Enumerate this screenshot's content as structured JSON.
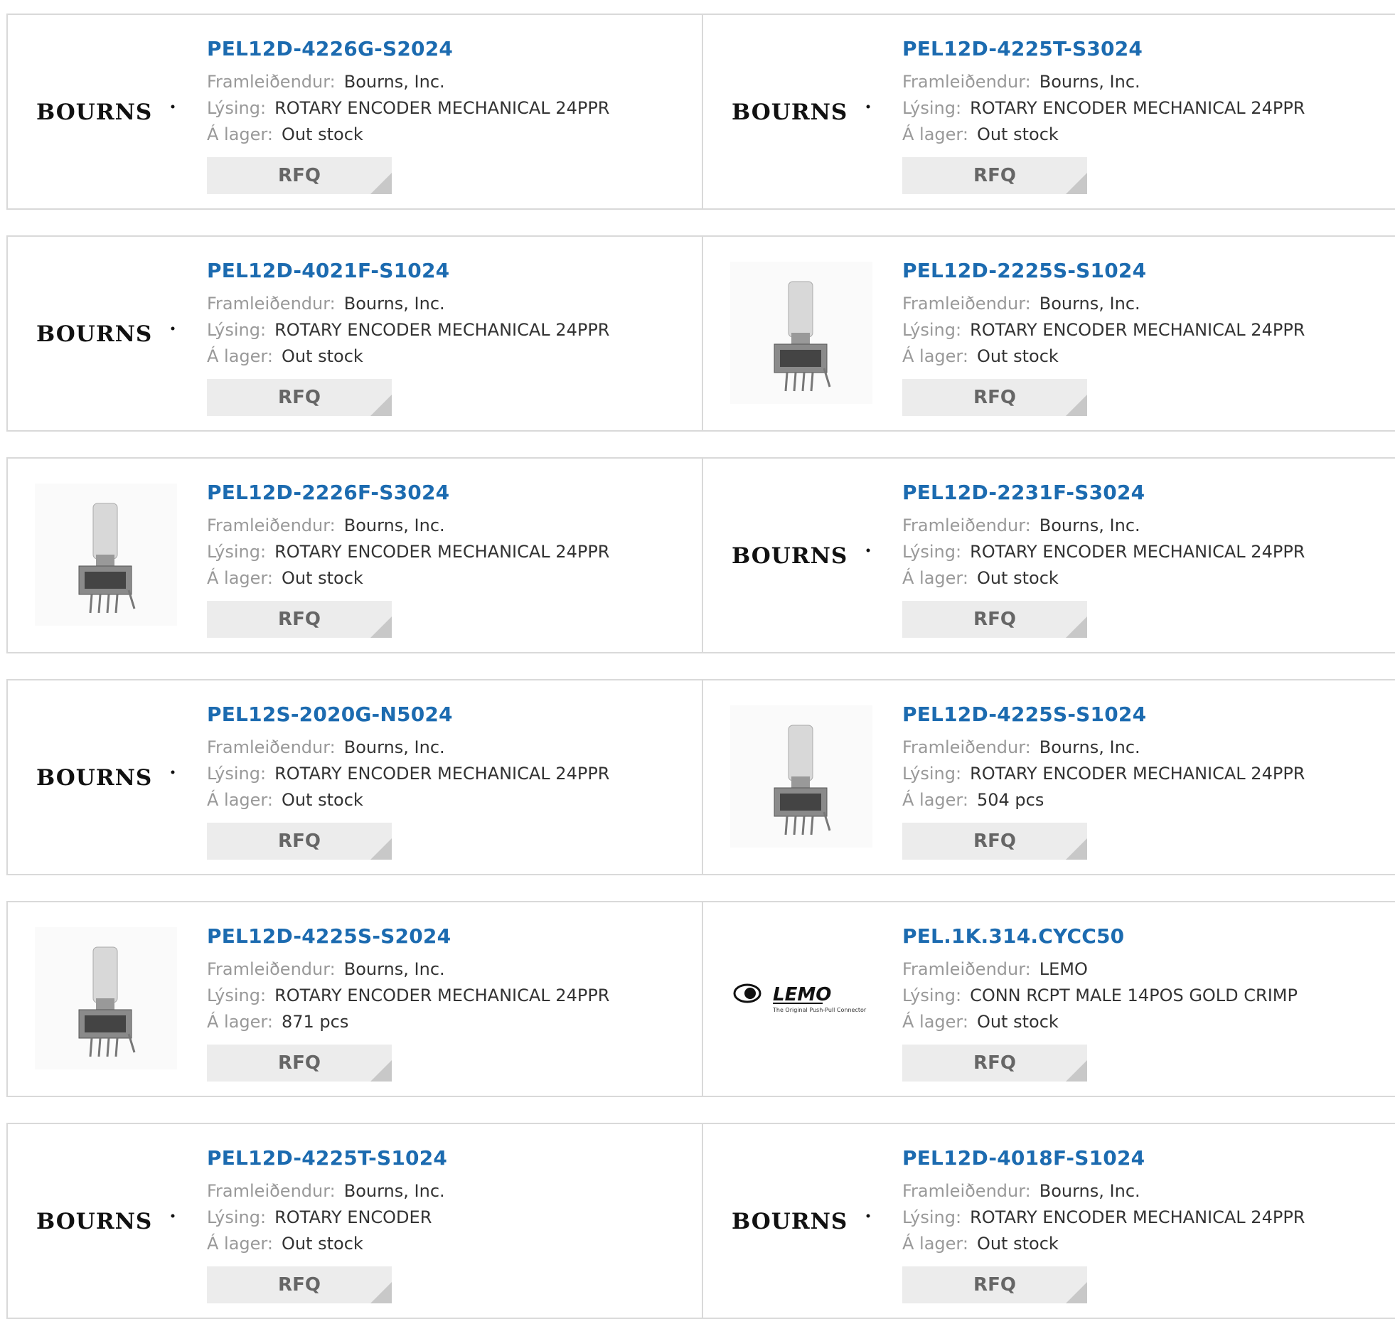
{
  "labels": {
    "manufacturer": "Framleiðendur:",
    "description": "Lýsing:",
    "stock": "Á lager:",
    "rfq": "RFQ"
  },
  "logos": {
    "bourns": "BOURNS",
    "lemo": "LEMO",
    "lemo_tagline": "The Original Push-Pull Connector"
  },
  "products": [
    {
      "part": "PEL12D-4226G-S2024",
      "manufacturer": "Bourns, Inc.",
      "description": "ROTARY ENCODER MECHANICAL 24PPR",
      "stock": "Out stock",
      "image": "bourns-logo"
    },
    {
      "part": "PEL12D-4225T-S3024",
      "manufacturer": "Bourns, Inc.",
      "description": "ROTARY ENCODER MECHANICAL 24PPR",
      "stock": "Out stock",
      "image": "bourns-logo"
    },
    {
      "part": "PEL12D-4021F-S1024",
      "manufacturer": "Bourns, Inc.",
      "description": "ROTARY ENCODER MECHANICAL 24PPR",
      "stock": "Out stock",
      "image": "bourns-logo"
    },
    {
      "part": "PEL12D-2225S-S1024",
      "manufacturer": "Bourns, Inc.",
      "description": "ROTARY ENCODER MECHANICAL 24PPR",
      "stock": "Out stock",
      "image": "encoder-photo"
    },
    {
      "part": "PEL12D-2226F-S3024",
      "manufacturer": "Bourns, Inc.",
      "description": "ROTARY ENCODER MECHANICAL 24PPR",
      "stock": "Out stock",
      "image": "encoder-photo"
    },
    {
      "part": "PEL12D-2231F-S3024",
      "manufacturer": "Bourns, Inc.",
      "description": "ROTARY ENCODER MECHANICAL 24PPR",
      "stock": "Out stock",
      "image": "bourns-logo"
    },
    {
      "part": "PEL12S-2020G-N5024",
      "manufacturer": "Bourns, Inc.",
      "description": "ROTARY ENCODER MECHANICAL 24PPR",
      "stock": "Out stock",
      "image": "bourns-logo"
    },
    {
      "part": "PEL12D-4225S-S1024",
      "manufacturer": "Bourns, Inc.",
      "description": "ROTARY ENCODER MECHANICAL 24PPR",
      "stock": "504 pcs",
      "image": "encoder-photo"
    },
    {
      "part": "PEL12D-4225S-S2024",
      "manufacturer": "Bourns, Inc.",
      "description": "ROTARY ENCODER MECHANICAL 24PPR",
      "stock": "871 pcs",
      "image": "encoder-photo"
    },
    {
      "part": "PEL.1K.314.CYCC50",
      "manufacturer": "LEMO",
      "description": "CONN RCPT MALE 14POS GOLD CRIMP",
      "stock": "Out stock",
      "image": "lemo-logo"
    },
    {
      "part": "PEL12D-4225T-S1024",
      "manufacturer": "Bourns, Inc.",
      "description": "ROTARY ENCODER",
      "stock": "Out stock",
      "image": "bourns-logo"
    },
    {
      "part": "PEL12D-4018F-S1024",
      "manufacturer": "Bourns, Inc.",
      "description": "ROTARY ENCODER MECHANICAL 24PPR",
      "stock": "Out stock",
      "image": "bourns-logo"
    }
  ]
}
